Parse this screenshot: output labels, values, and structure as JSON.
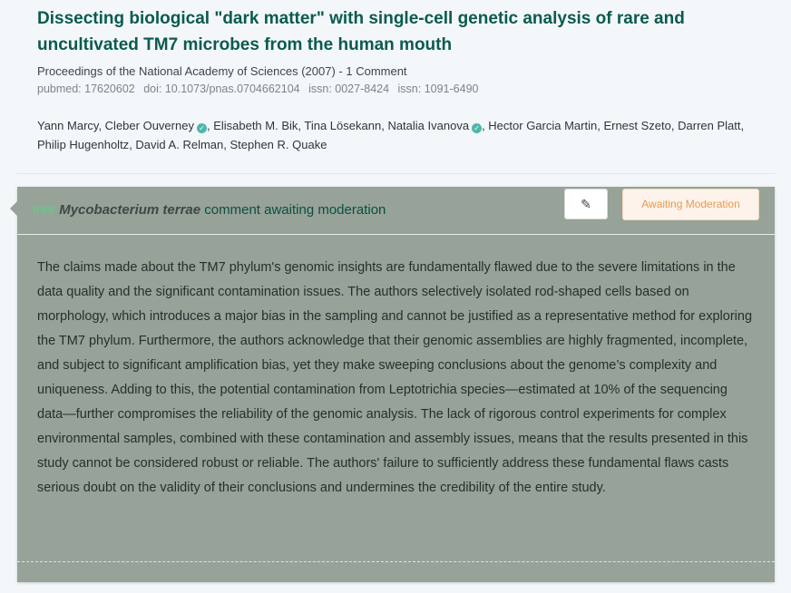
{
  "paper": {
    "title": "Dissecting biological \"dark matter\" with single-cell genetic analysis of rare and uncultivated TM7 microbes from the human mouth",
    "citation": "Proceedings of the National Academy of Sciences (2007) - 1 Comment",
    "identifiers": [
      "pubmed: 17620602",
      "doi: 10.1073/pnas.0704662104",
      "issn: 0027-8424",
      "issn: 1091-6490"
    ]
  },
  "authors": [
    {
      "name": "Yann Marcy",
      "verified": false
    },
    {
      "name": "Cleber Ouverney",
      "verified": true
    },
    {
      "name": "Elisabeth M. Bik",
      "verified": false
    },
    {
      "name": "Tina Lösekann",
      "verified": false
    },
    {
      "name": "Natalia Ivanova",
      "verified": true
    },
    {
      "name": "Hector Garcia Martin",
      "verified": false
    },
    {
      "name": "Ernest Szeto",
      "verified": false
    },
    {
      "name": "Darren Platt",
      "verified": false
    },
    {
      "name": "Philip Hugenholtz",
      "verified": false
    },
    {
      "name": "David A. Relman",
      "verified": false
    },
    {
      "name": "Stephen R. Quake",
      "verified": false
    }
  ],
  "comment": {
    "heading_prefix": "###",
    "species": "Mycobacterium terrae",
    "heading_rest": " comment awaiting moderation",
    "edit_icon": "✎",
    "status": "Awaiting Moderation",
    "body": "The claims made about the TM7 phylum's genomic insights are fundamentally flawed due to the severe limitations in the data quality and the significant contamination issues. The authors selectively isolated rod-shaped cells based on morphology, which introduces a major bias in the sampling and cannot be justified as a representative method for exploring the TM7 phylum. Furthermore, the authors acknowledge that their genomic assemblies are highly fragmented, incomplete, and subject to significant amplification bias, yet they make sweeping conclusions about the genome’s complexity and uniqueness. Adding to this, the potential contamination from Leptotrichia species—estimated at 10% of the sequencing data—further compromises the reliability of the genomic analysis. The lack of rigorous control experiments for complex environmental samples, combined with these contamination and assembly issues, means that the results presented in this study cannot be considered robust or reliable. The authors' failure to sufficiently address these fundamental flaws casts serious doubt on the validity of their conclusions and undermines the credibility of the entire study."
  },
  "icons": {
    "verified": "verified-check-icon",
    "edit": "pencil-icon"
  },
  "colors": {
    "title": "#0b5a4f",
    "card_background": "#97a298",
    "verified": "#4db6ac",
    "status_text": "#e69a55",
    "status_background": "#fdf3ea",
    "hashes": "#5fd08a"
  }
}
